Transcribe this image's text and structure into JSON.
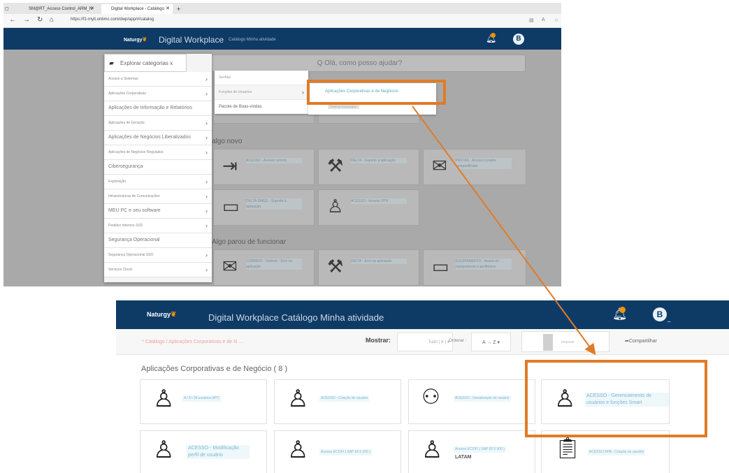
{
  "browser": {
    "tab1": "SM@RT_Access Control_ARM_N",
    "tab2": "Digital Workplace - Catálogo",
    "url": "https://f1-myit.onbmc.com/dwp/app/#/catalog"
  },
  "top_screen": {
    "brand": "Naturgy",
    "app_title": "Digital Workplace",
    "app_subtitle": "Catálogo Minha atividade",
    "avatar_letter": "B",
    "search_placeholder": "Q Olá, como posso ajudar?",
    "explore_label": "Explorar categorias x",
    "categories": [
      "Acesso a Sistemas",
      "Aplicações Corporativas",
      "Aplicações de Informação e Relatórios",
      "Aplicações de Geração",
      "Aplicações de Negócios Liberalizados",
      "Aplicações de Negócios Regulados",
      "Cibersegurança",
      "Exploração",
      "Infraestruturas de Comunicações",
      "MEU PC e seu software",
      "Pedidos Internos SSD",
      "Segurança Operacional",
      "Segurança Operacional SSO",
      "Serviços Cloud"
    ],
    "submenu1": [
      "Senhas",
      "Funções de Usuarios",
      "Pacote de Boas-vindas"
    ],
    "submenu2": [
      "Aplicações Corporativas e de Negócios",
      "Perfil de Funcionário"
    ],
    "section_new": "algo novo",
    "section_broken": "Algo parou de funcionar",
    "cards_new": [
      "ACESSO - Acesso remoto",
      "DELTA - Suporte à aplicação",
      "PASTAS - Acesso à pasta compartilhada",
      "DELTA SMILE - Suporte à aplicação",
      "ACESSO - Acesso VPN"
    ],
    "cards_broken": [
      "CORREIO - Outlook - Erro na aplicação",
      "DELTA - Erro na aplicação",
      "EQUIPAMENTO - Avaria do equipamento e periféricos"
    ]
  },
  "bottom_screen": {
    "brand": "Naturgy",
    "app_title": "Digital Workplace Catálogo Minha atividade",
    "avatar_letter": "B",
    "breadcrumb": "* Catálogo / Aplicações Corporativas e de N ....",
    "show_label": "Mostrar:",
    "show_value": "Tudo ( 8 )",
    "order_label": "Ordenar :",
    "order_value": "A → Z",
    "search_placeholder": "esquisar",
    "share_label": "Compartilhar",
    "section_title": "Aplicações Corporativas e de Negócio ( 8 )",
    "cards": [
      {
        "label": "A / R / M usuários BPC",
        "icon": "user-lock-icon"
      },
      {
        "label": "ACESSO - Criação de usuário",
        "icon": "user-lock-icon"
      },
      {
        "label": "ACESSO - Desativação de usuário",
        "icon": "agent-icon"
      },
      {
        "label": "ACESSO - Gerenciamento de usuários e funções Smart",
        "icon": "user-lock-icon"
      },
      {
        "label": "ACESSO - Modificação perfil de usuário",
        "icon": "user-lock-icon"
      },
      {
        "label": "Acesso ECOFI ( SAP EF3 200 )",
        "icon": "user-lock-icon"
      },
      {
        "label": "Acesso ECOFI ( SAP EF3 300 )",
        "sub": "LATAM",
        "icon": "user-lock-icon"
      },
      {
        "label": "ACESSO RPA - Criação de usuário",
        "icon": "clipboard-icon"
      }
    ]
  },
  "colors": {
    "header": "#0d3b66",
    "highlight": "#e07b27",
    "accent": "#f39200"
  }
}
